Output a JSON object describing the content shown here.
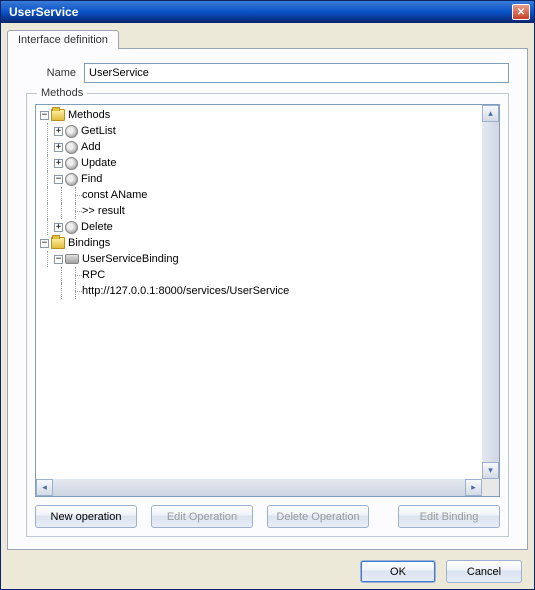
{
  "window": {
    "title": "UserService"
  },
  "tabs": [
    {
      "label": "Interface definition"
    }
  ],
  "form": {
    "name_label": "Name",
    "name_value": "UserService"
  },
  "methods_group": {
    "legend": "Methods",
    "tree": {
      "methods_node": "Methods",
      "ops": [
        {
          "name": "GetList",
          "expanded": false
        },
        {
          "name": "Add",
          "expanded": false
        },
        {
          "name": "Update",
          "expanded": false
        },
        {
          "name": "Find",
          "expanded": true,
          "children": [
            "const  AName",
            ">> result"
          ]
        },
        {
          "name": "Delete",
          "expanded": false
        }
      ],
      "bindings_node": "Bindings",
      "bindings": [
        {
          "name": "UserServiceBinding",
          "expanded": true,
          "children": [
            "RPC",
            "http://127.0.0.1:8000/services/UserService"
          ]
        }
      ]
    }
  },
  "buttons": {
    "new_op": "New operation",
    "edit_op": "Edit Operation",
    "del_op": "Delete Operation",
    "edit_binding": "Edit Binding",
    "ok": "OK",
    "cancel": "Cancel"
  }
}
